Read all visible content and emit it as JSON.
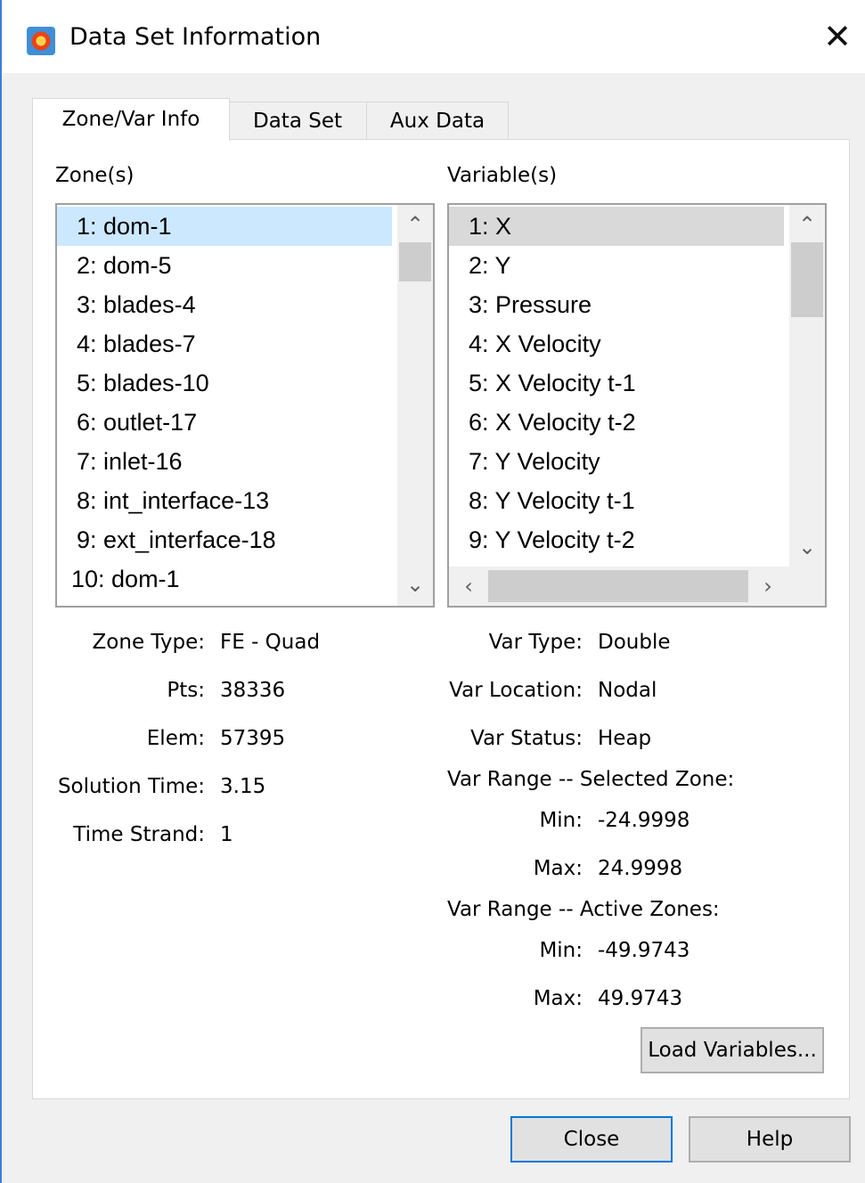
{
  "window": {
    "title": "Data Set Information",
    "close_glyph": "✕",
    "icon": "tecplot-app-icon"
  },
  "tabs": [
    {
      "label": "Zone/Var Info",
      "active": true
    },
    {
      "label": "Data Set",
      "active": false
    },
    {
      "label": "Aux Data",
      "active": false
    }
  ],
  "zones": {
    "header": "Zone(s)",
    "items": [
      "1: dom-1",
      "2: dom-5",
      "3: blades-4",
      "4: blades-7",
      "5: blades-10",
      "6: outlet-17",
      "7: inlet-16",
      "8: int_interface-13",
      "9: ext_interface-18",
      "10: dom-1"
    ],
    "selected_index": 0
  },
  "variables": {
    "header": "Variable(s)",
    "items": [
      "1: X",
      "2: Y",
      "3: Pressure",
      "4: X Velocity",
      "5: X Velocity t-1",
      "6: X Velocity t-2",
      "7: Y Velocity",
      "8: Y Velocity t-1",
      "9: Y Velocity t-2"
    ],
    "selected_index": 0
  },
  "zone_info": {
    "zone_type_label": "Zone Type:",
    "zone_type": "FE - Quad",
    "pts_label": "Pts:",
    "pts": "38336",
    "elem_label": "Elem:",
    "elem": "57395",
    "solution_time_label": "Solution Time:",
    "solution_time": "3.15",
    "time_strand_label": "Time Strand:",
    "time_strand": "1"
  },
  "var_info": {
    "var_type_label": "Var Type:",
    "var_type": "Double",
    "var_location_label": "Var Location:",
    "var_location": "Nodal",
    "var_status_label": "Var Status:",
    "var_status": "Heap",
    "selected_zone_header": "Var Range -- Selected Zone:",
    "selected_min_label": "Min:",
    "selected_min": "-24.9998",
    "selected_max_label": "Max:",
    "selected_max": "24.9998",
    "active_zones_header": "Var Range -- Active Zones:",
    "active_min_label": "Min:",
    "active_min": "-49.9743",
    "active_max_label": "Max:",
    "active_max": "49.9743"
  },
  "buttons": {
    "load_variables": "Load Variables...",
    "close": "Close",
    "help": "Help"
  },
  "glyphs": {
    "up": "⌃",
    "down": "⌄",
    "left": "‹",
    "right": "›"
  }
}
